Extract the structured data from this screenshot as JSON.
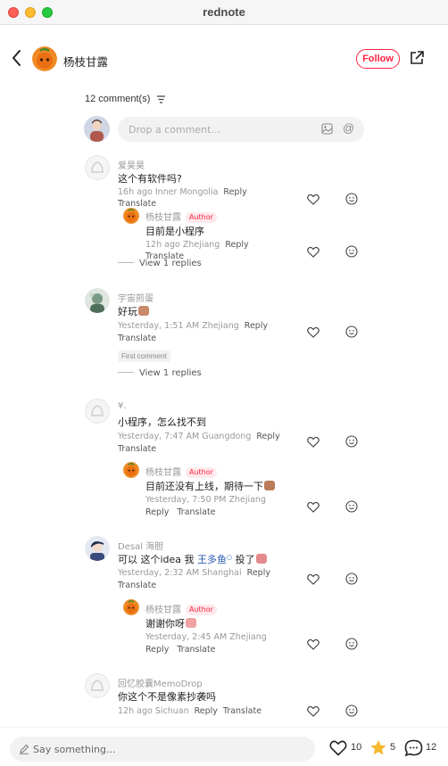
{
  "window": {
    "title": "rednote"
  },
  "header": {
    "username": "杨枝甘露",
    "follow_label": "Follow"
  },
  "comments_header": {
    "count_label": "12 comment(s)"
  },
  "comment_input": {
    "placeholder": "Drop a comment..."
  },
  "comments": [
    {
      "user": "爱昊昊",
      "text": "这个有软件吗?",
      "meta": "16h ago Inner Mongolia",
      "reply": "Reply",
      "translate": "Translate",
      "replies": [
        {
          "user": "杨枝甘露",
          "badge": "Author",
          "text": "目前是小程序",
          "meta": "12h ago Zhejiang",
          "reply": "Reply",
          "translate": "Translate"
        }
      ],
      "view_replies": "View 1 replies"
    },
    {
      "user": "宇宙煎蛋",
      "text": "好玩",
      "meta": "Yesterday, 1:51 AM Zhejiang",
      "reply": "Reply",
      "translate": "Translate",
      "tag": "First comment",
      "view_replies": "View 1 replies"
    },
    {
      "user": "¥.",
      "text": "小程序，怎么找不到",
      "meta": "Yesterday, 7:47 AM Guangdong",
      "reply": "Reply",
      "translate": "Translate",
      "replies": [
        {
          "user": "杨枝甘露",
          "badge": "Author",
          "text": "目前还没有上线，期待一下",
          "meta": "Yesterday, 7:50 PM Zhejiang",
          "reply": "Reply",
          "translate": "Translate"
        }
      ]
    },
    {
      "user": "Desal 海胆",
      "text_before": "可以 这个idea 我 ",
      "mention": "王多鱼",
      "text_after": " 投了",
      "meta": "Yesterday, 2:32 AM Shanghai",
      "reply": "Reply",
      "translate": "Translate",
      "replies": [
        {
          "user": "杨枝甘露",
          "badge": "Author",
          "text": "谢谢你呀",
          "meta": "Yesterday, 2:45 AM Zhejiang",
          "reply": "Reply",
          "translate": "Translate"
        }
      ]
    },
    {
      "user": "回忆胶囊MemoDrop",
      "text": "你这个不是像素抄袭吗",
      "meta": "12h ago Sichuan",
      "reply": "Reply",
      "translate": "Translate"
    }
  ],
  "bottom_bar": {
    "placeholder": "Say something...",
    "likes": "10",
    "stars": "5",
    "comments": "12"
  },
  "colors": {
    "accent": "#ff2442",
    "mention": "#2c5cb4",
    "star": "#f5b82e"
  },
  "icons": [
    "back-arrow-icon",
    "share-icon",
    "filter-icon",
    "image-icon",
    "at-icon",
    "heart-icon",
    "emoji-icon",
    "pen-icon",
    "star-icon",
    "chat-bubble-icon"
  ]
}
